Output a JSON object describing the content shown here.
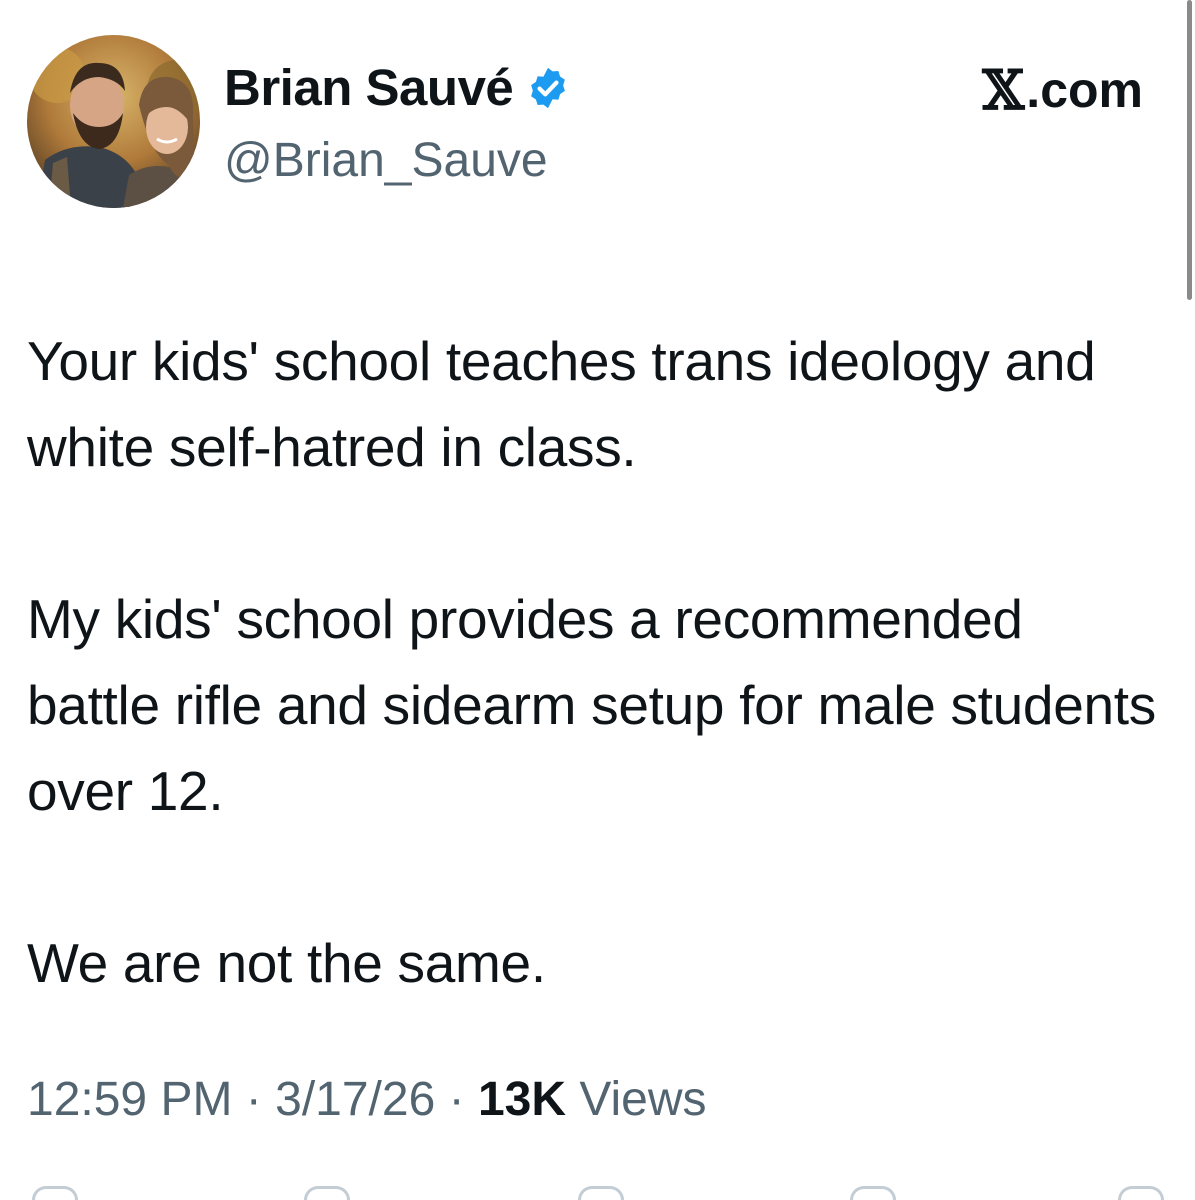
{
  "author": {
    "display_name": "Brian Sauvé",
    "handle": "@Brian_Sauve",
    "verified_icon": "verified-badge-icon",
    "avatar": "profile-photo"
  },
  "brand": {
    "logo_letter": "𝕏",
    "logo_suffix": ".com"
  },
  "tweet": {
    "paragraphs": [
      "Your kids' school teaches trans ideology and white self-hatred in class.",
      "My kids' school provides a recommended battle rifle and sidearm setup for male students over 12.",
      "We are not the same."
    ]
  },
  "meta": {
    "time": "12:59 PM",
    "separator": "·",
    "date": "3/17/26",
    "views_count": "13K",
    "views_label": "Views"
  },
  "colors": {
    "text": "#0f1419",
    "secondary": "#536471",
    "verified": "#1d9bf0"
  },
  "icons": {
    "reply": "reply-icon",
    "repost": "repost-icon",
    "like": "like-icon",
    "bookmark": "bookmark-icon",
    "share": "share-icon"
  }
}
